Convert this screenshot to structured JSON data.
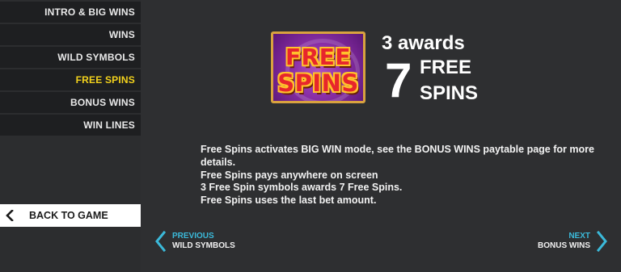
{
  "nav": {
    "items": [
      {
        "label": "INTRO & BIG WINS",
        "active": false
      },
      {
        "label": "WINS",
        "active": false
      },
      {
        "label": "WILD SYMBOLS",
        "active": false
      },
      {
        "label": "FREE SPINS",
        "active": true
      },
      {
        "label": "BONUS WINS",
        "active": false
      },
      {
        "label": "WIN LINES",
        "active": false
      }
    ],
    "back_label": "BACK TO GAME",
    "back_icon": "chevron-left-icon"
  },
  "symbol": {
    "line1": "FREE",
    "line2": "SPINS"
  },
  "award": {
    "text": "3 awards",
    "number": "7",
    "line1": "FREE",
    "line2": "SPINS"
  },
  "description": [
    "Free Spins activates BIG WIN mode, see the BONUS WINS paytable page for more details.",
    "Free Spins pays anywhere on screen",
    "3 Free Spin symbols awards 7 Free Spins.",
    "Free Spins uses the last bet amount."
  ],
  "pager": {
    "prev_label": "PREVIOUS",
    "prev_target": "WILD SYMBOLS",
    "next_label": "NEXT",
    "next_target": "BONUS WINS"
  },
  "colors": {
    "accent": "#3bb9d9",
    "active": "#f3d21c",
    "background": "#2c2d2f",
    "nav_background": "#1e1f21"
  }
}
